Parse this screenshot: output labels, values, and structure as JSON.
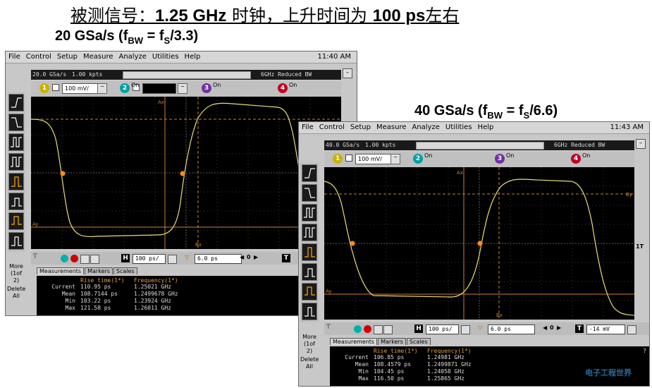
{
  "slide": {
    "title_prefix": "被测信号：",
    "title_freq": "1.25 GHz",
    "title_mid": " 时钟，上升时间为 ",
    "title_rise": "100 ps",
    "title_suffix": "左右"
  },
  "captions": {
    "left": {
      "main": "20 GSa/s (f",
      "sub1": "BW",
      "eq": " = f",
      "sub2": "S",
      "tail": "/3.3)"
    },
    "right": {
      "main": "40 GSa/s (f",
      "sub1": "BW",
      "eq": " = f",
      "sub2": "S",
      "tail": "/6.6)"
    }
  },
  "menu": [
    "File",
    "Control",
    "Setup",
    "Measure",
    "Analyze",
    "Utilities",
    "Help"
  ],
  "scope1": {
    "clock": "11:40 AM",
    "status_rate": "20.0 GSa/s",
    "status_pts": "1.00 kpts",
    "status_bw": "6GHz Reduced BW",
    "ch1_value": "100 mV/",
    "on_label": "On",
    "time_label": "H",
    "timebase": "100 ps/",
    "delay": "6.0 ps",
    "more": "More",
    "more_sub": "(1of 2)",
    "delete": "Delete",
    "delete_sub": "All",
    "tabs": [
      "Measurements",
      "Markers",
      "Scales"
    ],
    "meas_headers": [
      "Rise time(1*)",
      "Frequency(1*)"
    ],
    "meas_rows": [
      {
        "label": "Current",
        "rise": "110.95 ps",
        "freq": "1.25021 GHz"
      },
      {
        "label": "Mean",
        "rise": "108.7144 ps",
        "freq": "1.2499678 GHz"
      },
      {
        "label": "Min",
        "rise": "103.22 ps",
        "freq": "1.23924 GHz"
      },
      {
        "label": "Max",
        "rise": "121.58 ps",
        "freq": "1.26011 GHz"
      }
    ],
    "marker_ax": "Ax",
    "marker_bx": "Bx",
    "marker_ay": "Ay"
  },
  "scope2": {
    "clock": "11:43 AM",
    "status_rate": "40.0 GSa/s",
    "status_pts": "1.00 kpts",
    "status_bw": "6GHz Reduced BW",
    "ch1_value": "100 mV/",
    "on_label": "On",
    "time_label": "H",
    "timebase": "100 ps/",
    "delay": "6.0 ps",
    "trig_label": "T",
    "trig_level": "-14 mV",
    "more": "More",
    "more_sub": "(1of 2)",
    "delete": "Delete",
    "delete_sub": "All",
    "tabs": [
      "Measurements",
      "Markers",
      "Scales"
    ],
    "meas_headers": [
      "Rise time(1*)",
      "Frequency(1*)"
    ],
    "meas_rows": [
      {
        "label": "Current",
        "rise": "106.85 ps",
        "freq": "1.24981 GHz"
      },
      {
        "label": "Mean",
        "rise": "108.4579 ps",
        "freq": "1.2499871 GHz"
      },
      {
        "label": "Min",
        "rise": "104.45 ps",
        "freq": "1.24058 GHz"
      },
      {
        "label": "Max",
        "rise": "116.50 ps",
        "freq": "1.25865 GHz"
      }
    ],
    "marker_ax": "Ax",
    "marker_bx": "Bx",
    "marker_ay": "Ay",
    "marker_by": "By",
    "trig_marker": "1T"
  },
  "colors": {
    "trace": "#e8e070",
    "marker_dot": "#ff8c1a",
    "cursor": "#d08030",
    "grid": "#3a3a3a",
    "ch1": "#c8b400",
    "ch2": "#00a0a0",
    "ch3": "#7030a0",
    "ch4": "#c00020"
  },
  "watermark": "电子工程世界"
}
